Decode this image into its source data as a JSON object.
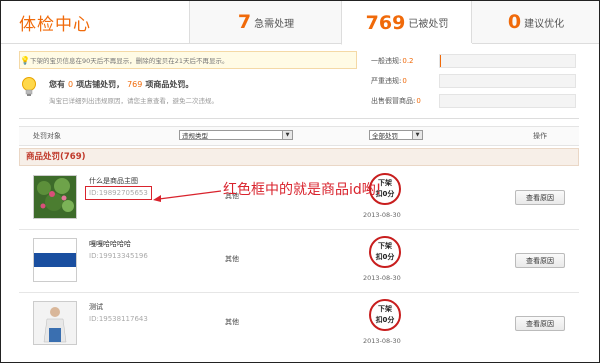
{
  "tabs": {
    "title": "体检中心",
    "pending": {
      "num": "7",
      "label": "急需处理"
    },
    "punished": {
      "num": "769",
      "label": "已被处罚"
    },
    "suggest": {
      "num": "0",
      "label": "建议优化"
    }
  },
  "notice": "下架的宝贝信息在90天后不再显示，删除的宝贝在21天后不再显示。",
  "summary": {
    "prefix": "您有",
    "shop_count": "0",
    "shop_label": "项店铺处罚，",
    "goods_count": "769",
    "goods_label": "项商品处罚。",
    "hint": "淘宝已详细列出违规原因，请您主意查看，避免二次违规。"
  },
  "stats": [
    {
      "label": "一般违规:",
      "value": "0.2",
      "fill": 0.01
    },
    {
      "label": "严重违规:",
      "value": "0",
      "fill": 0
    },
    {
      "label": "出售假冒商品:",
      "value": "0",
      "fill": 0
    }
  ],
  "filter": {
    "object_label": "处罚对象",
    "violation_select": "违规类型",
    "penalty_select": "全部处罚",
    "action_label": "操作"
  },
  "section_title": "商品处罚(769)",
  "annotation": "红色框中的就是商品id哟!",
  "rows": [
    {
      "name": "什么是商品主图",
      "id": "ID:19892705653",
      "type": "其他",
      "stamp1": "下架",
      "stamp2": "扣0分",
      "date": "2013-08-30",
      "button": "查看原因"
    },
    {
      "name": "嘎嘎哈哈哈哈",
      "id": "ID:19913345196",
      "type": "其他",
      "stamp1": "下架",
      "stamp2": "扣0分",
      "date": "2013-08-30",
      "button": "查看原因"
    },
    {
      "name": "测试",
      "id": "ID:19538117643",
      "type": "其他",
      "stamp1": "下架",
      "stamp2": "扣0分",
      "date": "2013-08-30",
      "button": "查看原因"
    }
  ],
  "colors": {
    "accent": "#f06a0a",
    "alert": "#d9232d"
  }
}
